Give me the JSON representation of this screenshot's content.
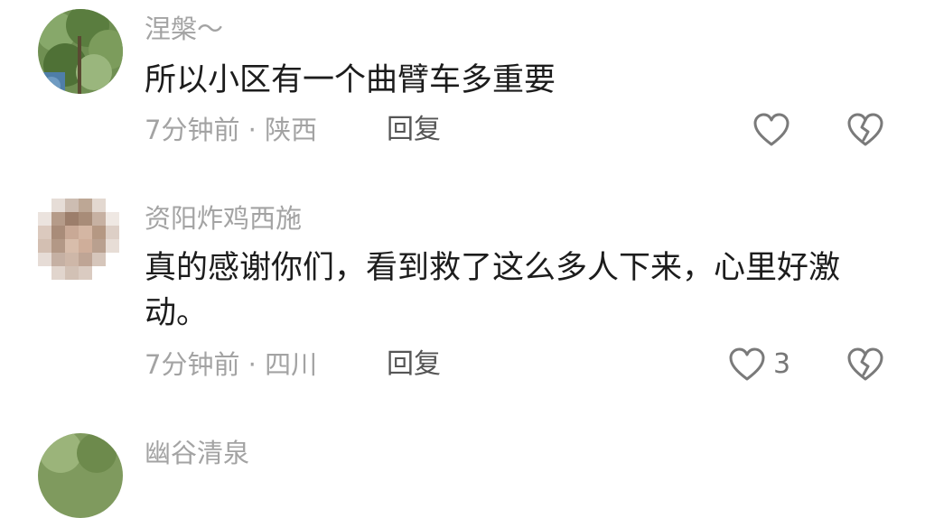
{
  "comments": [
    {
      "username": "涅槃～",
      "text": "所以小区有一个曲臂车多重要",
      "time_location": "7分钟前 · 陕西",
      "reply_label": "回复",
      "like_count": "",
      "avatar_icon": "tree-photo-avatar"
    },
    {
      "username": "资阳炸鸡西施",
      "text": "真的感谢你们，看到救了这么多人下来，心里好激动。",
      "time_location": "7分钟前 · 四川",
      "reply_label": "回复",
      "like_count": "3",
      "avatar_icon": "pixelated-avatar"
    },
    {
      "username": "幽谷清泉",
      "avatar_icon": "tree-photo-avatar"
    }
  ],
  "icons": {
    "like": "heart-outline-icon",
    "dislike": "broken-heart-icon"
  },
  "colors": {
    "meta_gray": "#a3a3a3",
    "body_text": "#1c1c1c",
    "icon_stroke": "#7a7a7a"
  }
}
